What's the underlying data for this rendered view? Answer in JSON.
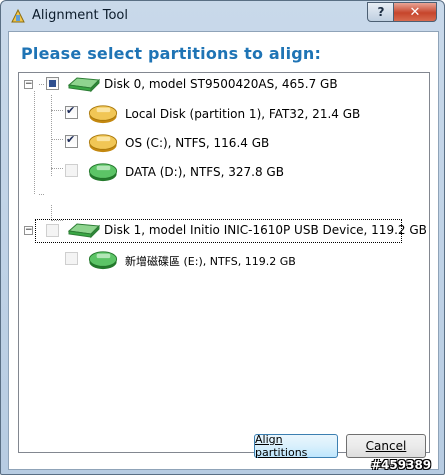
{
  "window": {
    "title": "Alignment Tool",
    "help_label": "?",
    "close_label": "✕"
  },
  "heading": "Please select partitions to align:",
  "tree": {
    "items": [
      {
        "label": "Disk 0, model ST9500420AS, 465.7 GB",
        "type": "disk",
        "check": "partial",
        "expanded": true
      },
      {
        "label": "Local Disk (partition 1), FAT32, 21.4 GB",
        "type": "partition",
        "check": "checked",
        "color": "#e0a82e"
      },
      {
        "label": "OS (C:), NTFS, 116.4 GB",
        "type": "partition",
        "check": "checked",
        "color": "#e0a82e"
      },
      {
        "label": "DATA (D:), NTFS, 327.8 GB",
        "type": "partition",
        "check": "unchecked",
        "color": "#3aa845"
      },
      {
        "label": "Disk 1, model Initio INIC-1610P USB Device, 119.2 GB",
        "type": "disk",
        "check": "unchecked",
        "expanded": true
      },
      {
        "label": "新增磁碟區 (E:), NTFS, 119.2 GB",
        "type": "partition",
        "check": "unchecked",
        "color": "#3aa845"
      }
    ],
    "expander_minus": "−"
  },
  "buttons": {
    "align_label": "Align partitions",
    "cancel_label": "Cancel"
  },
  "watermark": "#459389",
  "colors": {
    "heading": "#1f74b5",
    "disk_green": "#3aa845",
    "partition_gold": "#e0a82e"
  }
}
